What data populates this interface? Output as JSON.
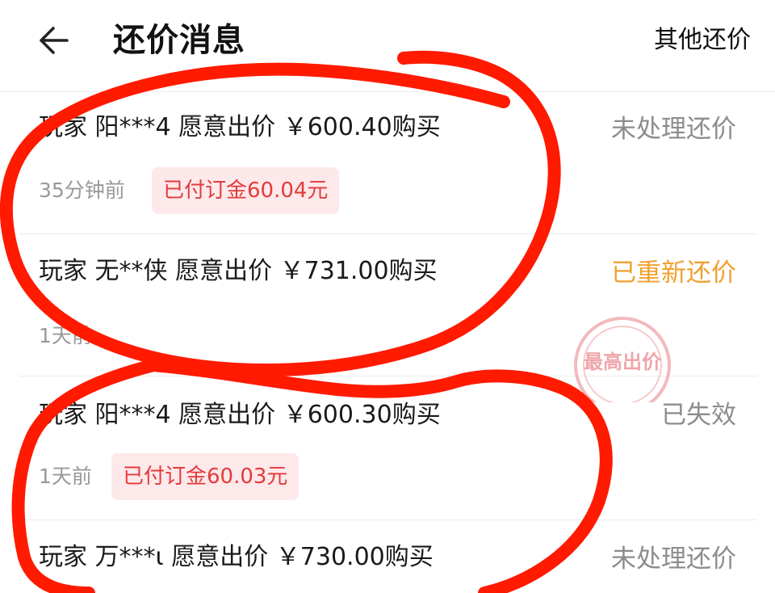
{
  "header": {
    "back_icon": "arrow-left-icon",
    "title": "还价消息",
    "other_label": "其他还价"
  },
  "offers": [
    {
      "player": "玩家 阳***4",
      "intent": "愿意出价",
      "price": "￥600.40",
      "action": "购买",
      "status": "未处理还价",
      "time": "35分钟前",
      "deposit_badge": "已付订金60.04元"
    },
    {
      "player": "玩家 无**侠",
      "intent": "愿意出价",
      "price": "￥731.00",
      "action": "购买",
      "status": "已重新还价",
      "time": "1天前",
      "stamp_text": "最高出价"
    },
    {
      "player": "玩家 阳***4",
      "intent": "愿意出价",
      "price": "￥600.30",
      "action": "购买",
      "status": "已失效",
      "time": "1天前",
      "deposit_badge": "已付订金60.03元"
    },
    {
      "player": "玩家 万***ι",
      "intent": "愿意出价",
      "price": "￥730.00",
      "action": "购买",
      "status": "未处理还价"
    }
  ],
  "colors": {
    "status_pending": "#8c8c8c",
    "status_recountered": "#f0a030",
    "badge_text": "#e33b3b",
    "badge_bg": "#fde8ea",
    "annotation_red": "#ff1a00"
  }
}
